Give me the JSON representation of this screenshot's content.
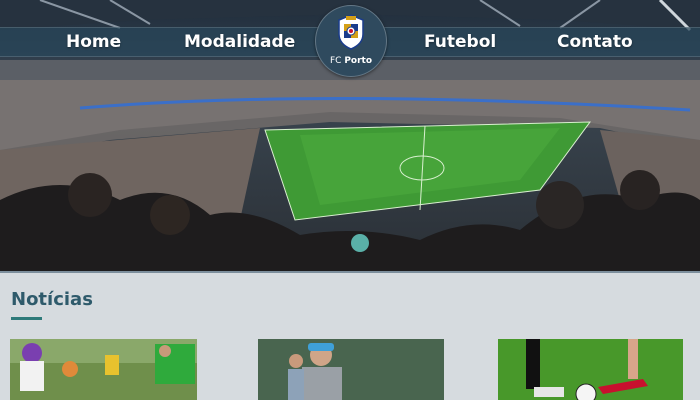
{
  "nav": {
    "items": [
      {
        "label": "Home"
      },
      {
        "label": "Modalidade"
      },
      {
        "label": "Futebol"
      },
      {
        "label": "Contato"
      }
    ]
  },
  "logo": {
    "text_light": "FC ",
    "text_bold": "Porto",
    "icon": "fc-porto-crest"
  },
  "hero": {
    "image": "stadium-crowd-photo"
  },
  "news": {
    "heading": "Notícias",
    "items": [
      {
        "image": "youth-soccer-players-photo"
      },
      {
        "image": "coach-training-photo"
      },
      {
        "image": "soccer-ball-kick-photo"
      }
    ]
  },
  "colors": {
    "navbar": "#28465a",
    "heading": "#2e5a6b",
    "underline": "#2e7a7a",
    "background": "#d6dbdf"
  }
}
